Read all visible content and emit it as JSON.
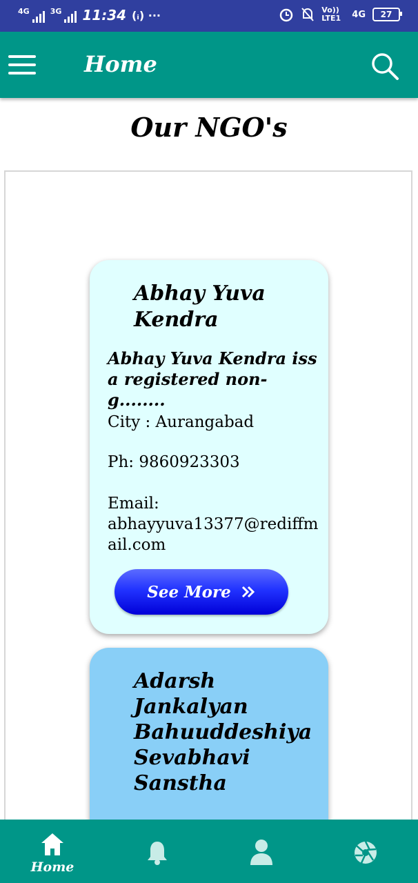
{
  "status_bar": {
    "network1": "4G",
    "network2": "3G",
    "time": "11:34",
    "extra": "(ᵢ) ···",
    "volte": "Vo)) LTE1",
    "network3": "4G",
    "battery": "27"
  },
  "app_bar": {
    "title": "Home",
    "menu_icon": "hamburger-menu-icon",
    "search_icon": "search-icon"
  },
  "page": {
    "heading": "Our NGO's"
  },
  "ngos": [
    {
      "name": "Abhay Yuva Kendra",
      "description": "Abhay Yuva Kendra iss a registered non-g........",
      "city": "City : Aurangabad",
      "phone": "Ph: 9860923303",
      "email_label": "Email:",
      "email": "abhayyuva13377@rediffmail.com",
      "button": "See More",
      "color": "#E0FFFF"
    },
    {
      "name": "Adarsh Jankalyan Bahuuddeshiya Sevabhavi Sanstha",
      "color": "#89CFF7"
    }
  ],
  "bottom_nav": {
    "items": [
      {
        "icon": "home-icon",
        "label": "Home"
      },
      {
        "icon": "bell-icon",
        "label": ""
      },
      {
        "icon": "person-icon",
        "label": ""
      },
      {
        "icon": "aperture-icon",
        "label": ""
      }
    ]
  }
}
